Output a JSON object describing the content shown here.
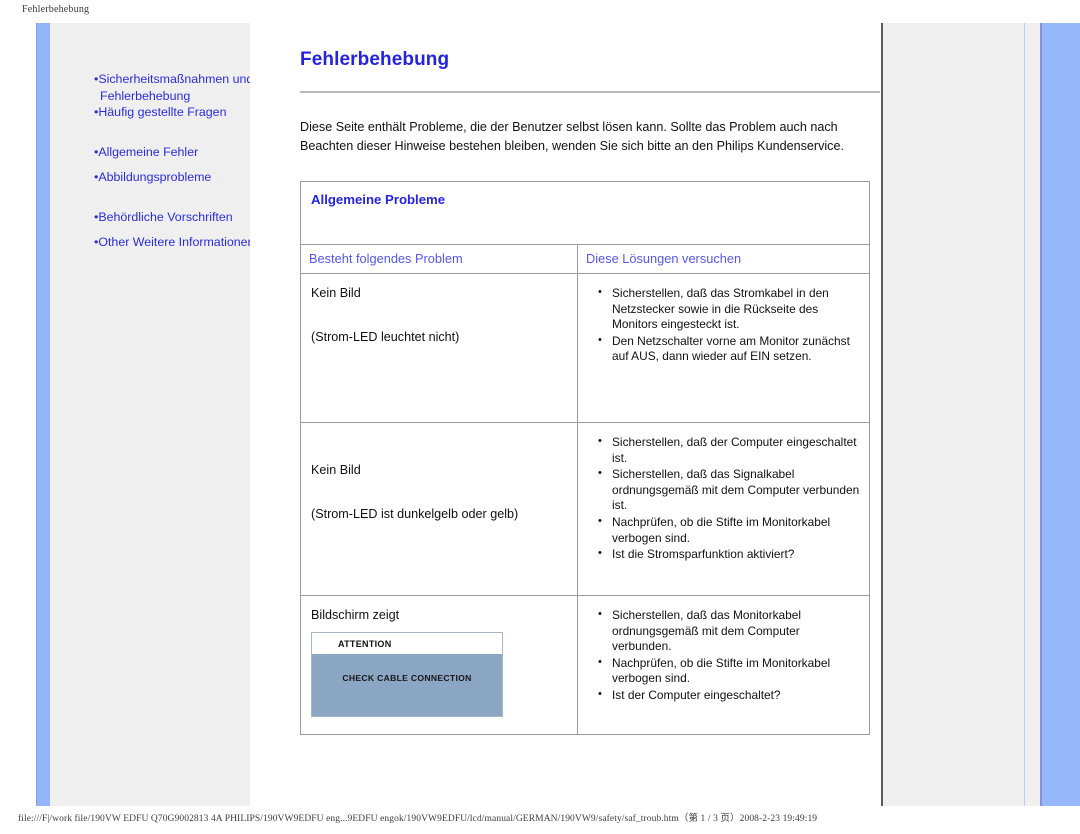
{
  "print": {
    "header_title": "Fehlerbehebung",
    "footer_path": "file:///F|/work file/190VW EDFU Q70G9002813 4A PHILIPS/190VW9EDFU eng...9EDFU engok/190VW9EDFU/lcd/manual/GERMAN/190VW9/safety/saf_troub.htm（第 1 / 3 页）2008-2-23 19:49:19"
  },
  "sidebar": {
    "groups": [
      {
        "items": [
          {
            "label": "Sicherheitsmaßnahmen und",
            "cont": "Fehlerbehebung"
          },
          {
            "label": "Häufig gestellte Fragen",
            "cont": ""
          }
        ]
      },
      {
        "items": [
          {
            "label": "Allgemeine Fehler",
            "cont": ""
          },
          {
            "label": "Abbildungsprobleme",
            "cont": ""
          }
        ]
      },
      {
        "items": [
          {
            "label": "Behördliche Vorschriften",
            "cont": ""
          },
          {
            "label": "Other Weitere Informationen",
            "cont": ""
          }
        ]
      }
    ]
  },
  "main": {
    "title": "Fehlerbehebung",
    "intro": "Diese Seite enthält Probleme, die der Benutzer selbst lösen kann. Sollte das Problem auch nach Beachten dieser Hinweise bestehen bleiben, wenden Sie sich bitte an den Philips Kundenservice.",
    "table": {
      "caption": "Allgemeine Probleme",
      "columns": [
        "Besteht folgendes Problem",
        "Diese Lösungen versuchen"
      ],
      "rows": [
        {
          "problem_line1": "Kein Bild",
          "problem_line2": "(Strom-LED leuchtet nicht)",
          "has_image": false,
          "solutions": [
            "Sicherstellen, daß das Stromkabel in den Netzstecker sowie in die Rückseite des Monitors eingesteckt ist.",
            "Den Netzschalter vorne am Monitor zunächst auf AUS, dann wieder auf EIN setzen."
          ]
        },
        {
          "problem_line1": "Kein Bild",
          "problem_line2": "(Strom-LED ist dunkelgelb oder gelb)",
          "has_image": false,
          "solutions": [
            "Sicherstellen, daß der Computer eingeschaltet ist.",
            "Sicherstellen, daß das Signalkabel ordnungsgemäß mit dem Computer verbunden ist.",
            "Nachprüfen, ob die Stifte im Monitorkabel verbogen sind.",
            "Ist die Stromsparfunktion aktiviert?"
          ]
        },
        {
          "problem_line1": "Bildschirm zeigt",
          "problem_line2": "",
          "has_image": true,
          "image": {
            "title": "ATTENTION",
            "message": "CHECK CABLE CONNECTION"
          },
          "solutions": [
            "Sicherstellen, daß das Monitorkabel ordnungsgemäß mit dem Computer verbunden.",
            "Nachprüfen, ob die Stifte im Monitorkabel verbogen sind.",
            "Ist der Computer eingeschaltet?"
          ]
        }
      ]
    }
  },
  "colors": {
    "link": "#2b2bd8",
    "title": "#2424e0",
    "rail": "#93b4f7",
    "shell": "#efefef",
    "attention_body": "#8ba6c2"
  }
}
